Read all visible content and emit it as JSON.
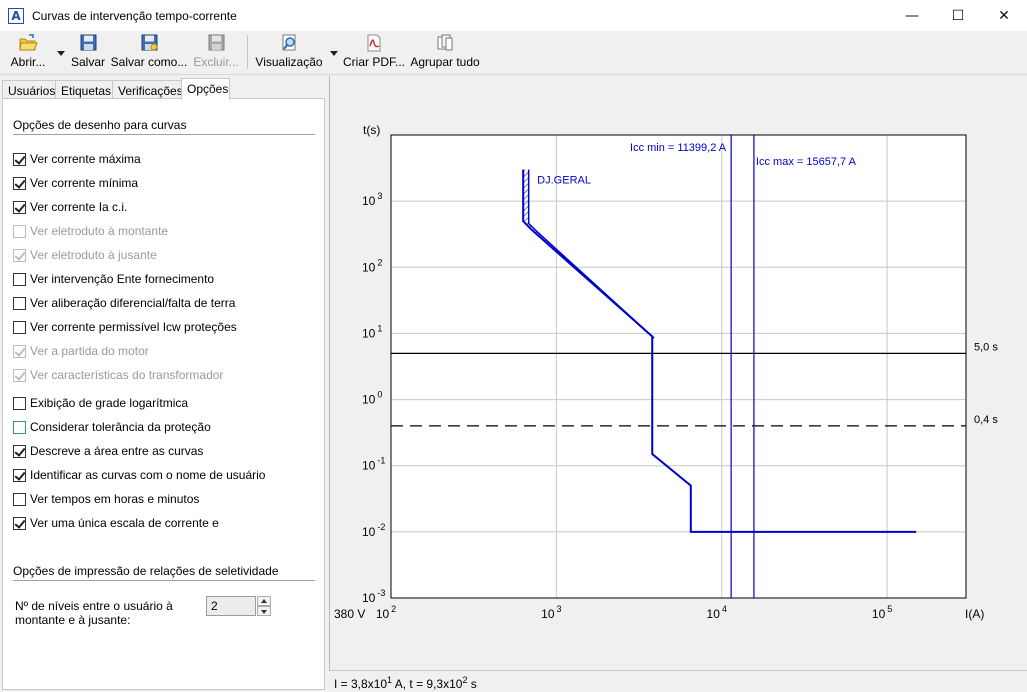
{
  "window": {
    "title": "Curvas de intervenção tempo-corrente",
    "minimize_glyph": "—",
    "maximize_glyph": "☐",
    "close_glyph": "✕"
  },
  "toolbar": {
    "open_label": "Abrir...",
    "save_label": "Salvar",
    "save_as_label": "Salvar como...",
    "delete_label": "Excluir...",
    "preview_label": "Visualização",
    "pdf_label": "Criar PDF...",
    "group_label": "Agrupar tudo"
  },
  "tabs": [
    "Usuários",
    "Etiquetas",
    "Verificações",
    "Opções"
  ],
  "options": {
    "drawing_section": "Opções de desenho para curvas",
    "items": [
      {
        "label": "Ver corrente máxima",
        "checked": true,
        "disabled": false
      },
      {
        "label": "Ver corrente mínima",
        "checked": true,
        "disabled": false
      },
      {
        "label": "Ver corrente Ia c.i.",
        "checked": true,
        "disabled": false
      },
      {
        "label": "Ver eletroduto à montante",
        "checked": false,
        "disabled": true
      },
      {
        "label": "Ver eletroduto à jusante",
        "checked": true,
        "disabled": true
      },
      {
        "label": "Ver intervenção Ente fornecimento",
        "checked": false,
        "disabled": false
      },
      {
        "label": "Ver aliberação diferencial/falta de terra",
        "checked": false,
        "disabled": false
      },
      {
        "label": "Ver corrente permissível Icw proteções",
        "checked": false,
        "disabled": false
      },
      {
        "label": "Ver a partida do motor",
        "checked": true,
        "disabled": true
      },
      {
        "label": "Ver características do transformador",
        "checked": true,
        "disabled": true
      },
      {
        "label": "Exibição de grade logarítmica",
        "checked": false,
        "disabled": false
      },
      {
        "label": "Considerar tolerância da proteção",
        "checked": false,
        "disabled": false
      },
      {
        "label": "Descreve a área entre as curvas",
        "checked": true,
        "disabled": false
      },
      {
        "label": "Identificar as curvas com o nome de usuário",
        "checked": true,
        "disabled": false
      },
      {
        "label": "Ver tempos em horas e minutos",
        "checked": false,
        "disabled": false
      },
      {
        "label": "Ver uma única escala de corrente e",
        "checked": true,
        "disabled": false
      }
    ],
    "print_section": "Opções de impressão de relações de seletividade",
    "levels_label": "Nº de níveis entre o usuário à montante e à jusante:",
    "levels_value": "2"
  },
  "chart_data": {
    "type": "line",
    "x_scale": "log",
    "y_scale": "log",
    "xlim": [
      100,
      300000
    ],
    "ylim": [
      0.001,
      10000
    ],
    "ylabel": "t(s)",
    "xlabel": "I(A)",
    "voltage_label": "380 V",
    "x_ticks": [
      {
        "base": "10",
        "exp": "2",
        "value": 100
      },
      {
        "base": "10",
        "exp": "3",
        "value": 1000
      },
      {
        "base": "10",
        "exp": "4",
        "value": 10000
      },
      {
        "base": "10",
        "exp": "5",
        "value": 100000
      }
    ],
    "y_ticks": [
      {
        "base": "10",
        "exp": "3",
        "value": 1000
      },
      {
        "base": "10",
        "exp": "2",
        "value": 100
      },
      {
        "base": "10",
        "exp": "1",
        "value": 10
      },
      {
        "base": "10",
        "exp": "0",
        "value": 1
      },
      {
        "base": "10",
        "exp": "-1",
        "value": 0.1
      },
      {
        "base": "10",
        "exp": "-2",
        "value": 0.01
      },
      {
        "base": "10",
        "exp": "-3",
        "value": 0.001
      }
    ],
    "curve": {
      "name": "DJ.GERAL",
      "color": "#0000cc",
      "points": [
        [
          630,
          3000
        ],
        [
          630,
          500
        ],
        [
          700,
          380
        ],
        [
          3800,
          9
        ],
        [
          3800,
          0.15
        ],
        [
          6500,
          0.05
        ],
        [
          6500,
          0.01
        ],
        [
          150000,
          0.01
        ]
      ],
      "band_right_points": [
        [
          680,
          3000
        ],
        [
          680,
          460
        ],
        [
          760,
          350
        ],
        [
          3900,
          8.5
        ]
      ]
    },
    "vertical_lines": [
      {
        "label": "Icc min = 11399,2 A",
        "x": 11399.2,
        "color": "#0000cc"
      },
      {
        "label": "Icc max = 15657,7 A",
        "x": 15657.7,
        "color": "#0000cc"
      }
    ],
    "horizontal_lines": [
      {
        "label": "5,0 s",
        "y": 5.0,
        "style": "solid"
      },
      {
        "label": "0,4 s",
        "y": 0.4,
        "style": "dashed"
      }
    ]
  },
  "status": {
    "text_prefix": "I = 3,8x10",
    "text_exp1": "1",
    "text_mid": " A,  t = 9,3x10",
    "text_exp2": "2",
    "text_suffix": " s"
  }
}
